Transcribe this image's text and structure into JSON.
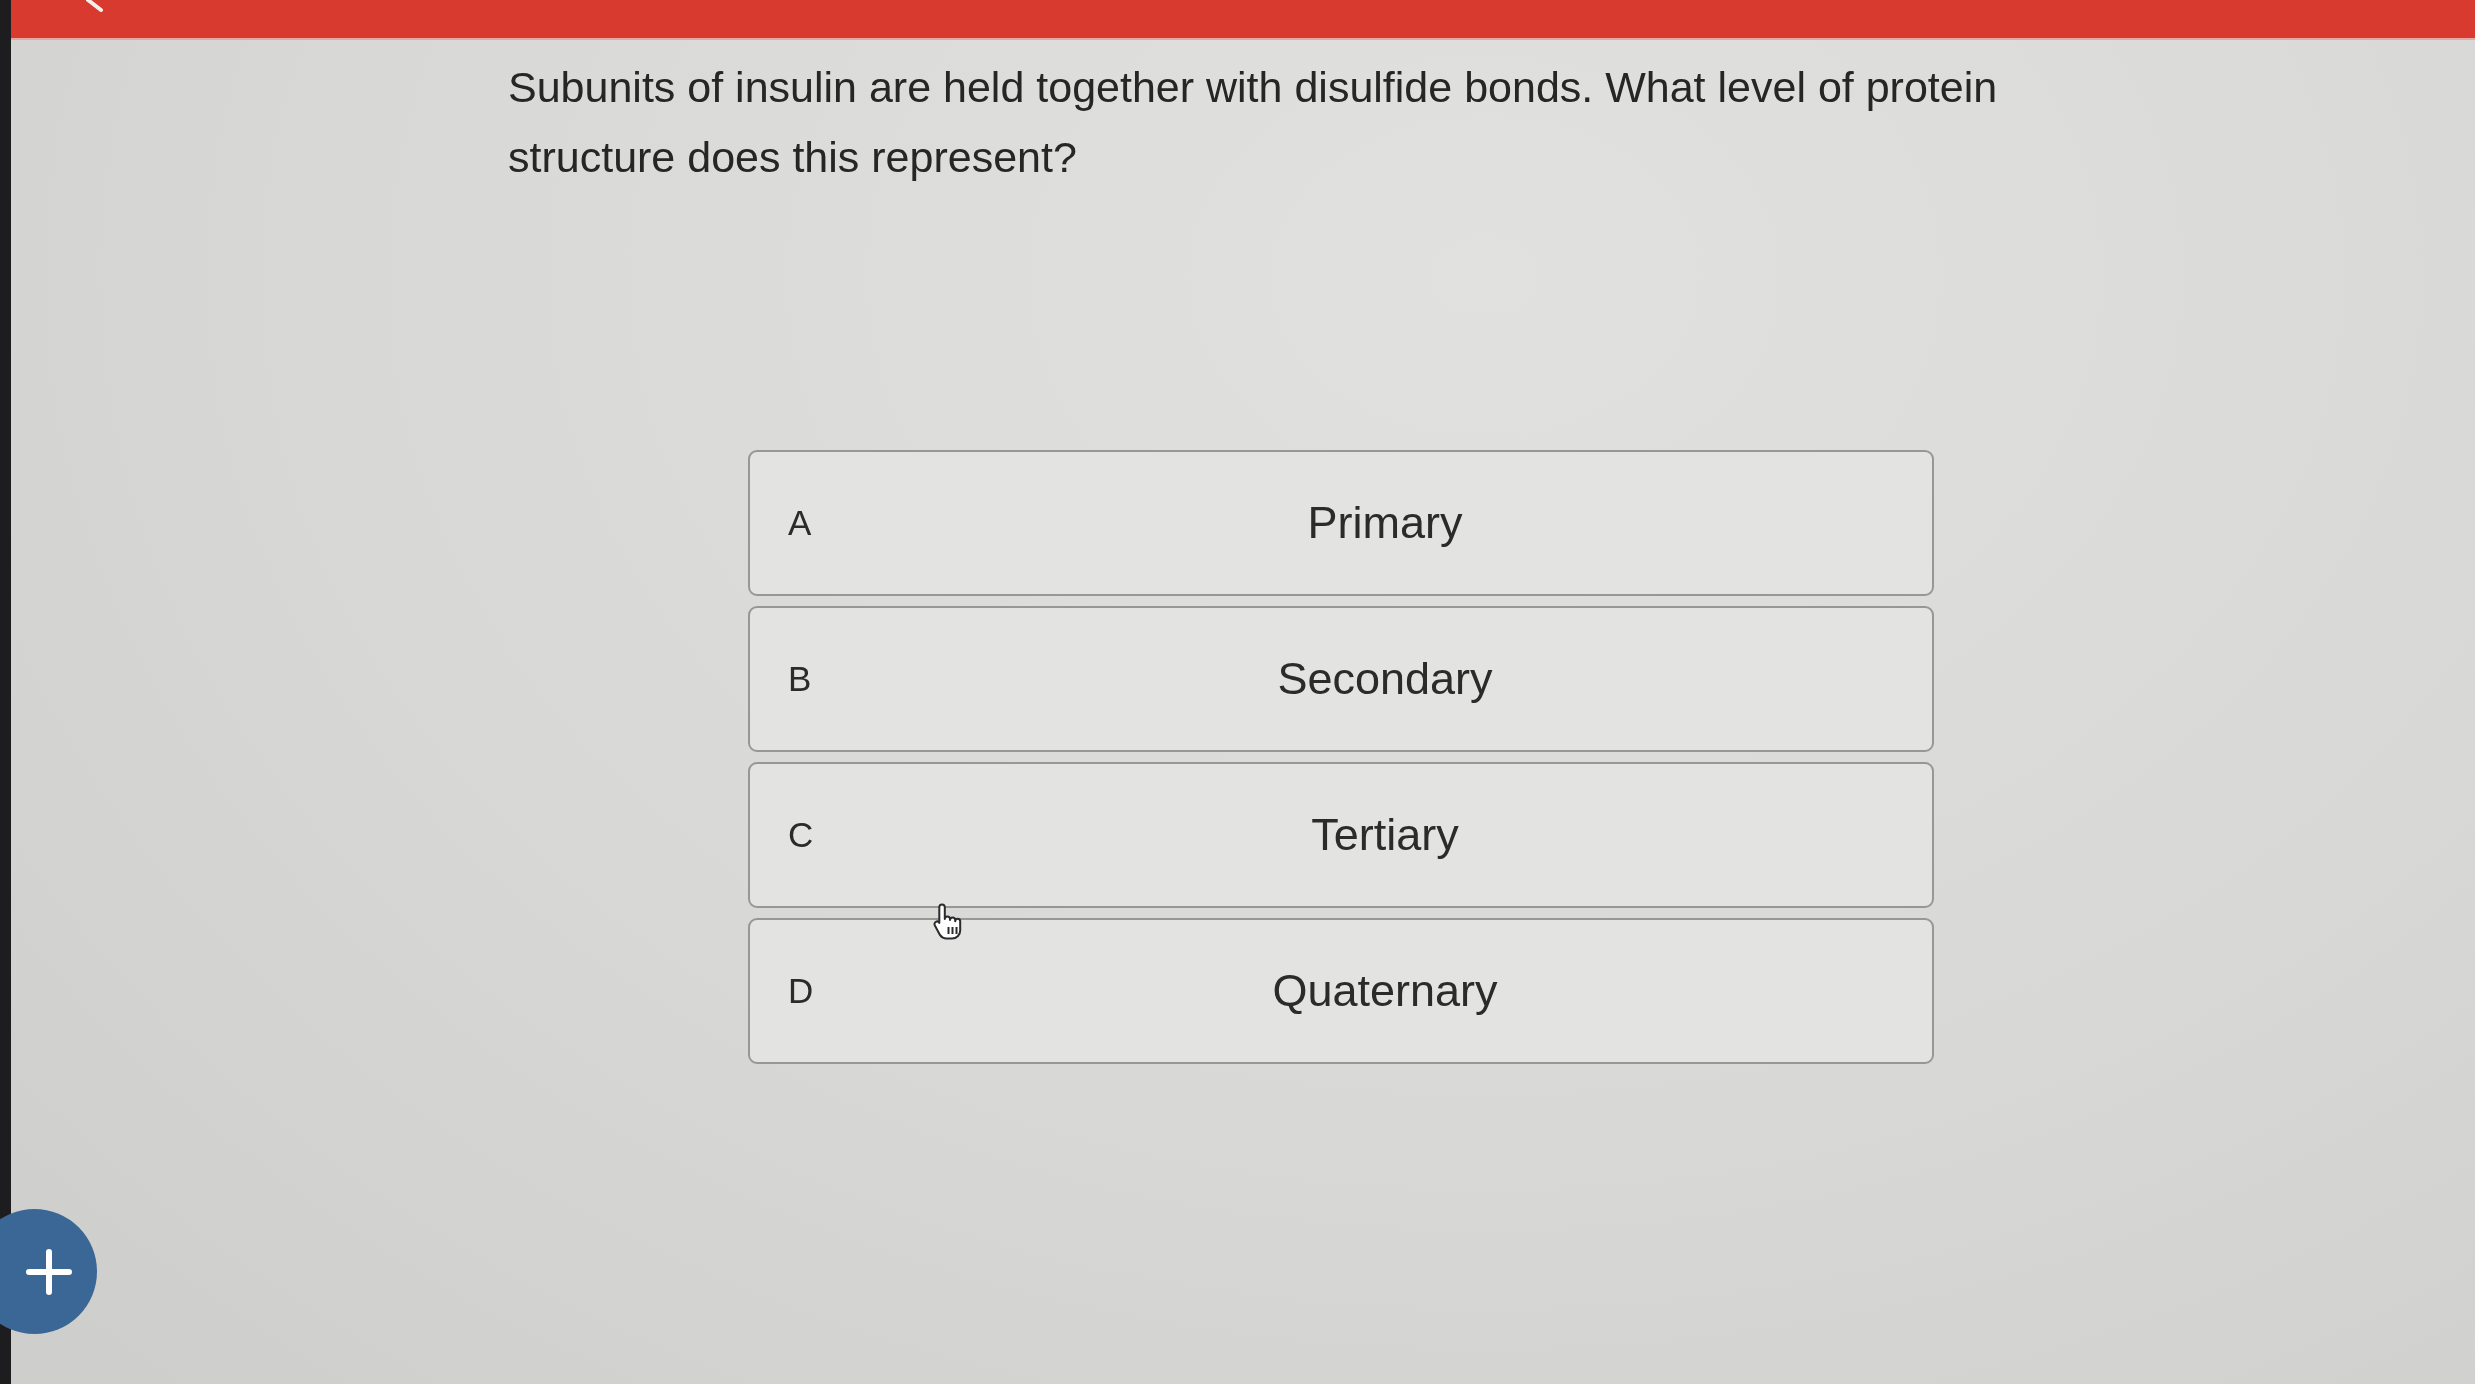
{
  "question": "Subunits of insulin are held together with disulfide bonds. What level of protein structure does this represent?",
  "options": [
    {
      "letter": "A",
      "text": "Primary",
      "selected": false
    },
    {
      "letter": "B",
      "text": "Secondary",
      "selected": false
    },
    {
      "letter": "C",
      "text": "Tertiary",
      "selected": false
    },
    {
      "letter": "D",
      "text": "Quaternary",
      "selected": false
    }
  ]
}
